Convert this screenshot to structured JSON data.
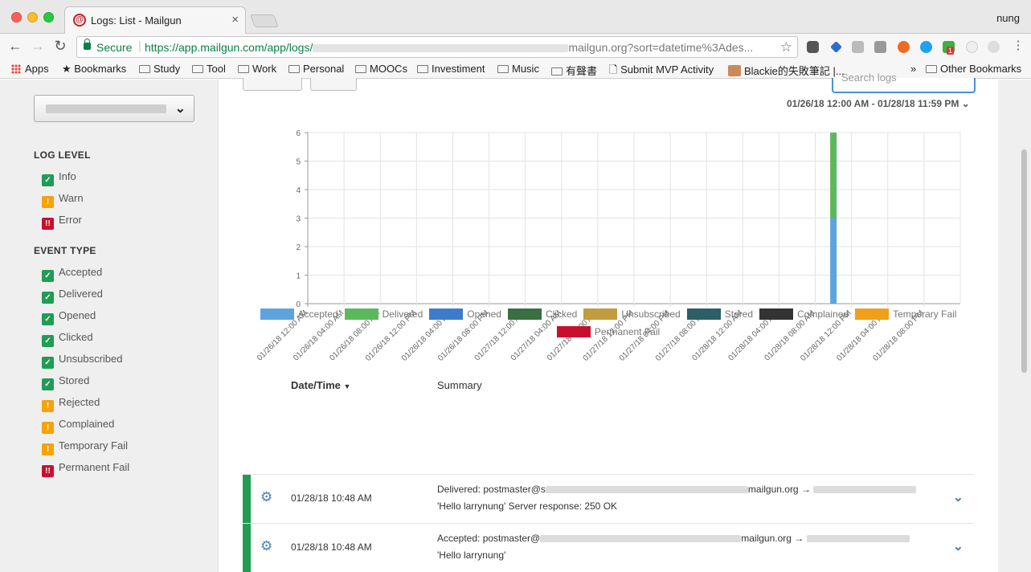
{
  "browser": {
    "tab_title": "Logs: List - Mailgun",
    "tab_close": "×",
    "profile": "nung",
    "secure_label": "Secure",
    "url_prefix": "https://app.mailgun.com/app/logs/",
    "url_suffix": "mailgun.org?sort=datetime%3Ades...",
    "bookmarks": [
      "Apps",
      "Bookmarks",
      "Study",
      "Tool",
      "Work",
      "Personal",
      "MOOCs",
      "Investiment",
      "Music",
      "有聲書",
      "Submit MVP Activity",
      "Blackie的失敗筆記 |...",
      "Other Bookmarks"
    ],
    "bookmarks_overflow": "»",
    "extension_badge": "1"
  },
  "sidebar": {
    "log_level_title": "LOG LEVEL",
    "log_levels": [
      {
        "label": "Info",
        "icon": "check-icon",
        "status": "ok"
      },
      {
        "label": "Warn",
        "icon": "warning-icon",
        "status": "warn"
      },
      {
        "label": "Error",
        "icon": "error-icon",
        "status": "err"
      }
    ],
    "event_type_title": "EVENT TYPE",
    "event_types": [
      {
        "label": "Accepted",
        "status": "ok"
      },
      {
        "label": "Delivered",
        "status": "ok"
      },
      {
        "label": "Opened",
        "status": "ok"
      },
      {
        "label": "Clicked",
        "status": "ok"
      },
      {
        "label": "Unsubscribed",
        "status": "ok"
      },
      {
        "label": "Stored",
        "status": "ok"
      },
      {
        "label": "Rejected",
        "status": "warn"
      },
      {
        "label": "Complained",
        "status": "warn"
      },
      {
        "label": "Temporary Fail",
        "status": "warn"
      },
      {
        "label": "Permanent Fail",
        "status": "err"
      }
    ]
  },
  "filters": {
    "search_placeholder": "Search logs",
    "date_range": "01/26/18 12:00 AM - 01/28/18 11:59 PM"
  },
  "chart_data": {
    "type": "bar",
    "stacked": true,
    "title": "",
    "xlabel": "",
    "ylabel": "",
    "ylim": [
      0,
      6
    ],
    "yticks": [
      0,
      1,
      2,
      3,
      4,
      5,
      6
    ],
    "categories": [
      "01/26/18 12:00 AM",
      "01/26/18 04:00 AM",
      "01/26/18 08:00 AM",
      "01/26/18 12:00 PM",
      "01/26/18 04:00 PM",
      "01/26/18 08:00 PM",
      "01/27/18 12:00 AM",
      "01/27/18 04:00 AM",
      "01/27/18 08:00 AM",
      "01/27/18 12:00 PM",
      "01/27/18 04:00 PM",
      "01/27/18 08:00 PM",
      "01/28/18 12:00 AM",
      "01/28/18 04:00 AM",
      "01/28/18 08:00 AM",
      "01/28/18 12:00 PM",
      "01/28/18 04:00 PM",
      "01/28/18 08:00 PM"
    ],
    "series": [
      {
        "name": "Accepted",
        "color": "#5da4dd",
        "points": [
          {
            "x": "01/28/18 10:00 AM",
            "y": 3
          }
        ]
      },
      {
        "name": "Delivered",
        "color": "#5cb85c",
        "points": [
          {
            "x": "01/28/18 10:00 AM",
            "y": 3
          }
        ]
      },
      {
        "name": "Opened",
        "color": "#3d7cc9",
        "points": []
      },
      {
        "name": "Clicked",
        "color": "#3a6e43",
        "points": []
      },
      {
        "name": "Unsubscribed",
        "color": "#c09c3e",
        "points": []
      },
      {
        "name": "Stored",
        "color": "#2e5e66",
        "points": []
      },
      {
        "name": "Complained",
        "color": "#333333",
        "points": []
      },
      {
        "name": "Temporary Fail",
        "color": "#f0a018",
        "points": []
      },
      {
        "name": "Permanent Fail",
        "color": "#c8102e",
        "points": []
      }
    ],
    "grid": true,
    "legend": "bottom"
  },
  "table": {
    "col_datetime": "Date/Time",
    "sort_indicator": "▼",
    "col_summary": "Summary",
    "rows": [
      {
        "datetime": "01/28/18 10:48 AM",
        "line1_prefix": "Delivered: postmaster@s",
        "line1_domain": "mailgun.org →",
        "line2": "'Hello larrynung' Server response: 250 OK"
      },
      {
        "datetime": "01/28/18 10:48 AM",
        "line1_prefix": "Accepted: postmaster@",
        "line1_domain": "mailgun.org →",
        "line2": "'Hello larrynung'"
      }
    ]
  }
}
